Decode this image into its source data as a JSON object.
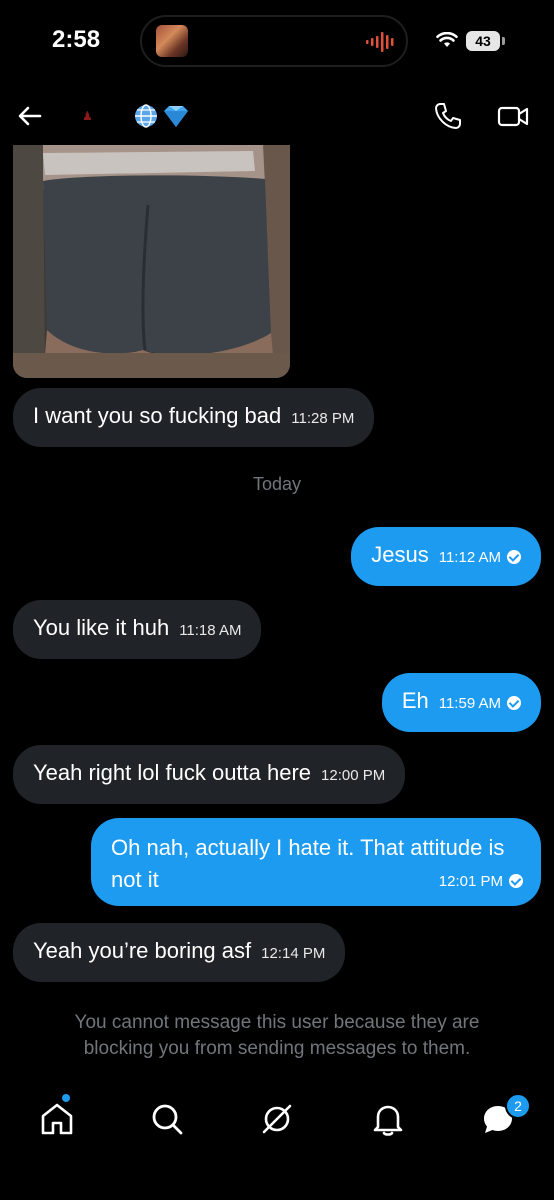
{
  "status": {
    "time": "2:58",
    "battery": "43"
  },
  "header": {
    "back_icon": "arrow-left-icon",
    "title_emojis": "globe, gem"
  },
  "messages": [
    {
      "text": "I want you so fucking bad",
      "time": "11:28 PM"
    },
    {
      "text": "Jesus",
      "time": "11:12 AM"
    },
    {
      "text": "You like it huh",
      "time": "11:18 AM"
    },
    {
      "text": "Eh",
      "time": "11:59 AM"
    },
    {
      "text": "Yeah right lol fuck outta here",
      "time": "12:00 PM"
    },
    {
      "text": "Oh nah, actually I hate it. That attitude is not it",
      "time": "12:01 PM"
    },
    {
      "text": "Yeah you’re boring asf",
      "time": "12:14 PM"
    }
  ],
  "divider": "Today",
  "blocked_notice": "You cannot message this user because they are blocking you from sending messages to them.",
  "tabbar": {
    "messages_badge": "2"
  },
  "colors": {
    "accent": "#1d9bf0",
    "received_bubble": "#202327",
    "background": "#000000"
  }
}
